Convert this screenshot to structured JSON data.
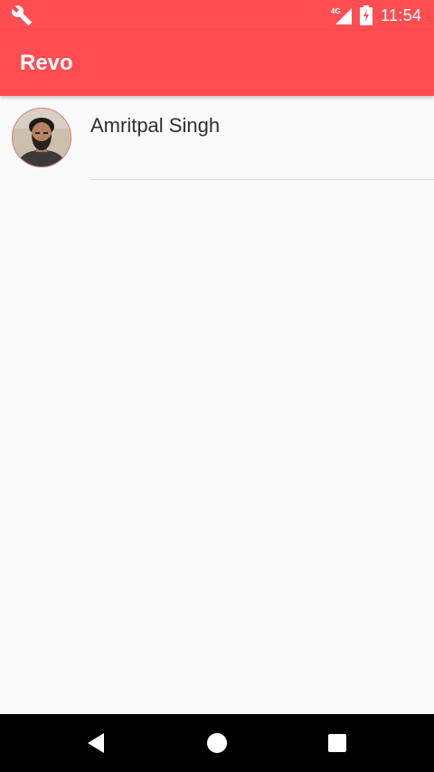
{
  "status_bar": {
    "time": "11:54",
    "network": "4G",
    "icons": [
      "wrench-icon",
      "signal-4g-icon",
      "battery-charging-icon"
    ]
  },
  "app_bar": {
    "title": "Revo"
  },
  "contacts": [
    {
      "name": "Amritpal Singh",
      "avatar": "profile-photo"
    }
  ],
  "nav_bar": {
    "buttons": [
      "back-icon",
      "home-icon",
      "recents-icon"
    ]
  },
  "colors": {
    "primary": "#ff4d52",
    "background": "#fafafa",
    "text": "#2f2f2f",
    "divider": "#d9d9d9",
    "nav": "#000000"
  }
}
